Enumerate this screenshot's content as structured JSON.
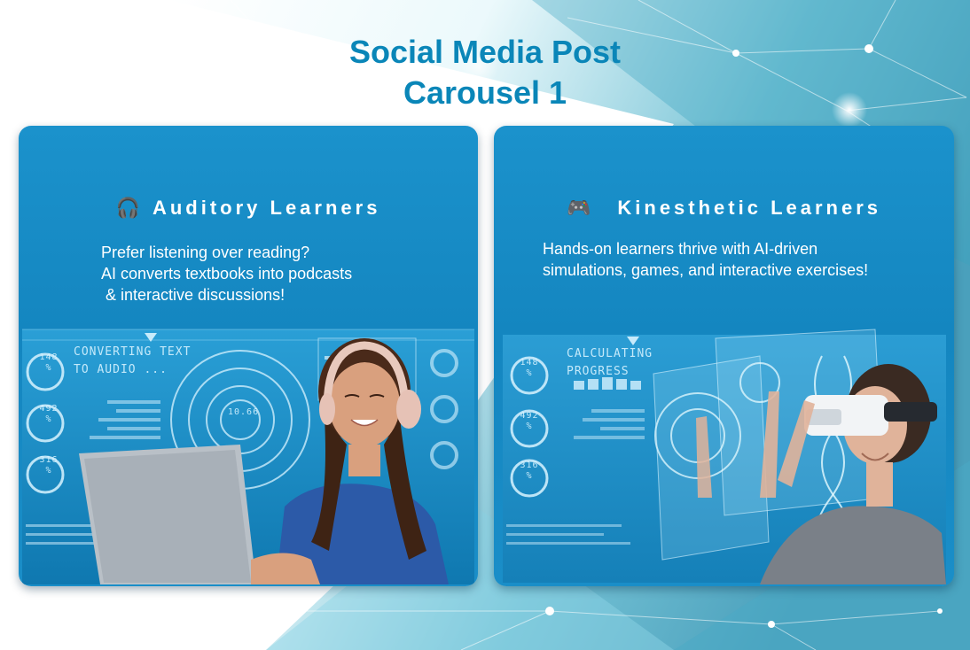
{
  "heading": {
    "line1": "Social Media Post",
    "line2": "Carousel 1"
  },
  "colors": {
    "heading": "#0a86b8",
    "card": "#1486c0",
    "network": "#8fd4e6"
  },
  "cards": [
    {
      "icon": "headphones-icon",
      "icon_glyph": "🎧",
      "title": "Auditory Learners",
      "body": [
        "Prefer listening over reading?",
        "AI converts textbooks into podcasts",
        " & interactive discussions!"
      ],
      "hud_text": [
        "CONVERTING TEXT",
        "TO AUDIO ..."
      ],
      "gauges": [
        "148 %",
        "492 %",
        "316 %"
      ],
      "dial_value": "10.66"
    },
    {
      "icon": "gamepad-icon",
      "icon_glyph": "🎮",
      "title": "Kinesthetic Learners",
      "body": [
        "Hands-on learners thrive with AI-driven",
        "simulations, games, and interactive exercises!"
      ],
      "hud_text": [
        "CALCULATING",
        "PROGRESS"
      ],
      "gauges": [
        "148 %",
        "492 %",
        "316 %"
      ]
    }
  ]
}
